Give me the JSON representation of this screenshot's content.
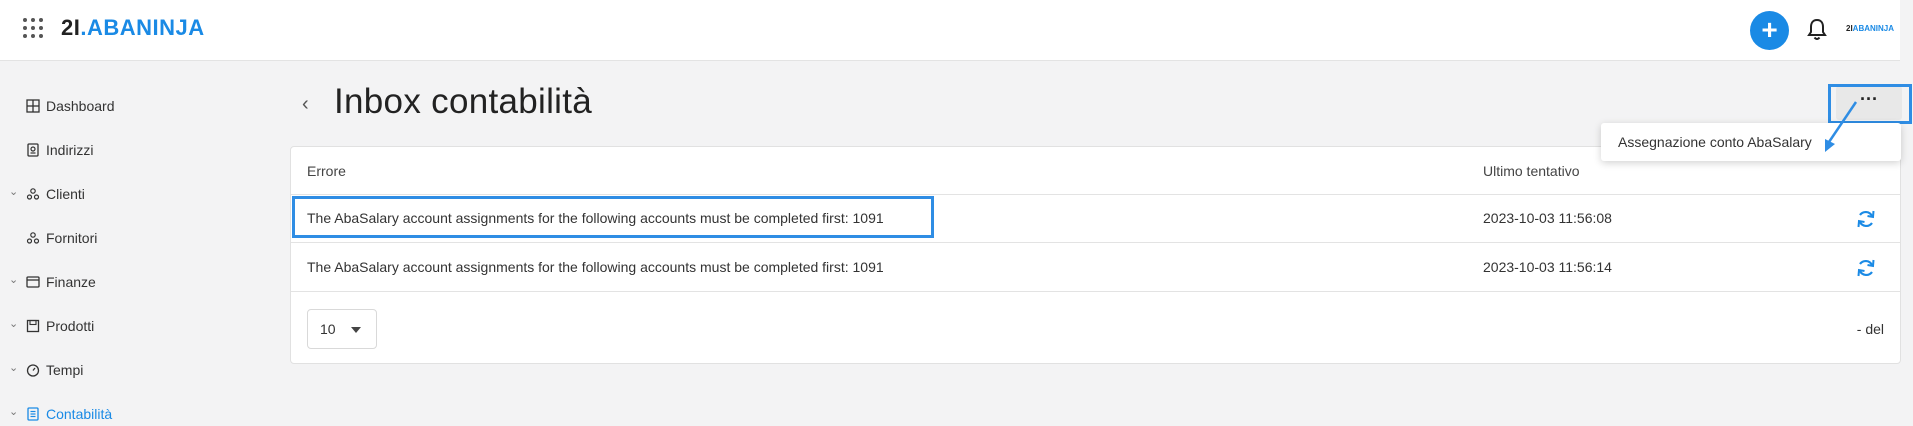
{
  "header": {
    "logo_num": "2I",
    "logo_dot": ".",
    "logo_brand": "ABANINJA",
    "mini_logo_num": "2I",
    "mini_logo_brand": "ABANINJA",
    "add_label": "+"
  },
  "sidebar": {
    "items": [
      {
        "label": "Dashboard",
        "icon": "dashboard-icon",
        "expandable": false
      },
      {
        "label": "Indirizzi",
        "icon": "address-book-icon",
        "expandable": false
      },
      {
        "label": "Clienti",
        "icon": "clients-icon",
        "expandable": true
      },
      {
        "label": "Fornitori",
        "icon": "suppliers-icon",
        "expandable": false
      },
      {
        "label": "Finanze",
        "icon": "finance-icon",
        "expandable": true
      },
      {
        "label": "Prodotti",
        "icon": "products-icon",
        "expandable": true
      },
      {
        "label": "Tempi",
        "icon": "time-icon",
        "expandable": true
      },
      {
        "label": "Contabilità",
        "icon": "accounting-icon",
        "expandable": true,
        "active": true
      }
    ]
  },
  "page": {
    "back": "‹",
    "title": "Inbox contabilità",
    "more": "···"
  },
  "table": {
    "columns": [
      "Errore",
      "Ultimo tentativo"
    ],
    "rows": [
      {
        "error": "The AbaSalary account assignments for the following accounts must be completed first: 1091",
        "timestamp": "2023-10-03 11:56:08"
      },
      {
        "error": "The AbaSalary account assignments for the following accounts must be completed first: 1091",
        "timestamp": "2023-10-03 11:56:14"
      }
    ],
    "page_size": "10",
    "pager_info": "- del"
  },
  "dropdown": {
    "option": "Assegnazione conto AbaSalary"
  },
  "colors": {
    "accent": "#1a8ae5",
    "highlight": "#2f8de4"
  }
}
